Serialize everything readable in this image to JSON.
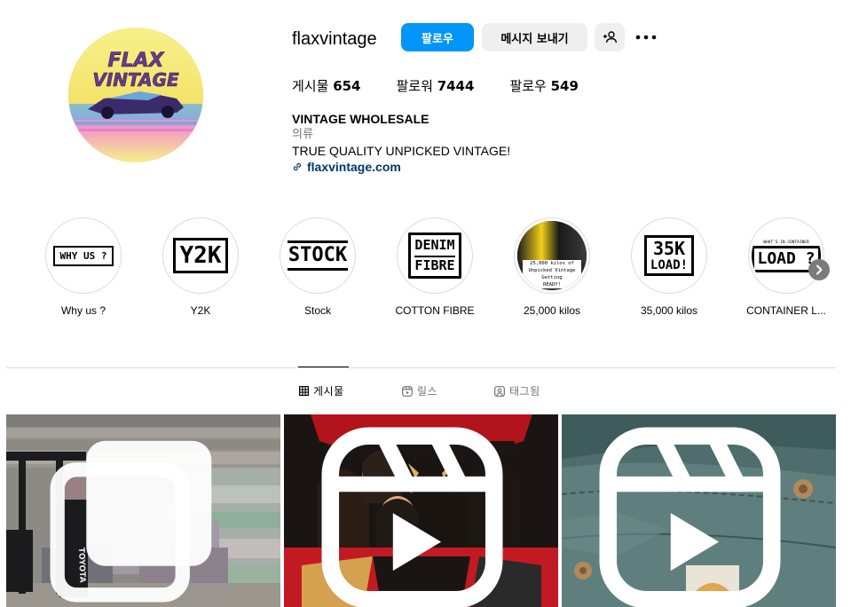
{
  "profile": {
    "username": "flaxvintage",
    "follow_label": "팔로우",
    "message_label": "메시지 보내기",
    "stats": {
      "posts_label": "게시물",
      "posts_count": "654",
      "followers_label": "팔로워",
      "followers_count": "7444",
      "following_label": "팔로우",
      "following_count": "549"
    },
    "bio": {
      "name": "VINTAGE WHOLESALE",
      "category": "의류",
      "line": "TRUE QUALITY UNPICKED VINTAGE!",
      "link": "flaxvintage.com"
    },
    "avatar_text": [
      "FLAX",
      "VINTAGE"
    ]
  },
  "highlights": [
    {
      "label": "Why us ?",
      "cover_text": "WHY US ?"
    },
    {
      "label": "Y2K",
      "cover_text": "Y2K"
    },
    {
      "label": "Stock",
      "cover_text": "STOCK"
    },
    {
      "label": "COTTON FIBRE",
      "cover_text_1": "DENIM",
      "cover_text_2": "FIBRE"
    },
    {
      "label": "25,000 kilos",
      "cover_text_1": "25,000 kilos of",
      "cover_text_2": "Unpicked Vintage",
      "cover_text_3": "Getting",
      "cover_text_4": "READY!"
    },
    {
      "label": "35,000 kilos",
      "cover_text_1": "35K",
      "cover_text_2": "LOAD!"
    },
    {
      "label": "CONTAINER L...",
      "cover_text_small": "WHAT'S IN CONTAINER",
      "cover_text": "LOAD ?"
    }
  ],
  "tabs": [
    {
      "label": "게시물",
      "icon": "grid-icon",
      "active": true
    },
    {
      "label": "릴스",
      "icon": "reels-icon",
      "active": false
    },
    {
      "label": "태그됨",
      "icon": "tagged-icon",
      "active": false
    }
  ],
  "posts": [
    {
      "type": "carousel",
      "icon": "carousel-icon",
      "forklift_text": "TOYOTA"
    },
    {
      "type": "reel",
      "icon": "reels-icon"
    },
    {
      "type": "reel",
      "icon": "reels-icon"
    }
  ],
  "colors": {
    "accent": "#0095f6",
    "secondary_button": "#efefef",
    "link": "#00376b",
    "muted_text": "#737373",
    "divider": "#dbdbdb"
  }
}
